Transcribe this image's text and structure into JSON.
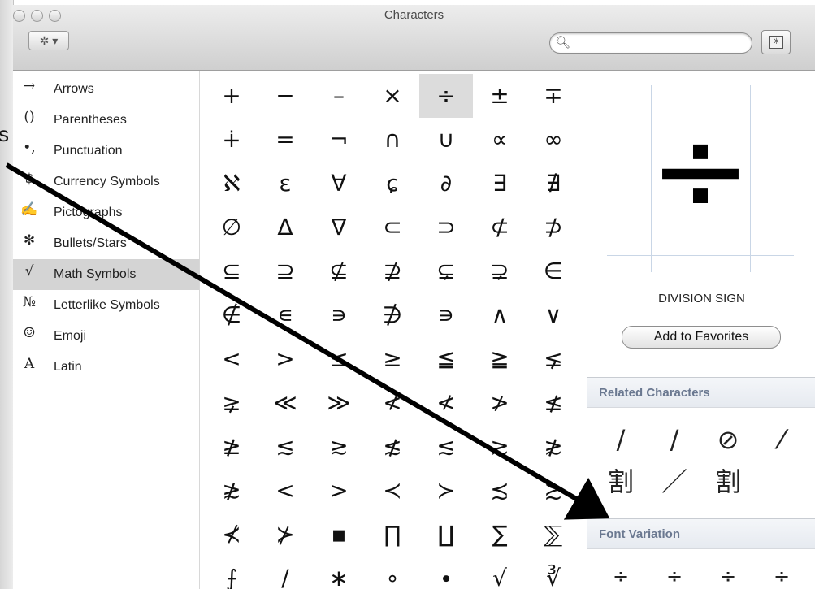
{
  "window": {
    "title": "Characters"
  },
  "toolbar": {
    "action_label": "✲ ▾",
    "search": {
      "value": "",
      "placeholder": ""
    },
    "view_toggle_icon": "keyboard-grid-icon"
  },
  "page_edge_fragment": "s",
  "sidebar": {
    "items": [
      {
        "icon": "→",
        "label": "Arrows"
      },
      {
        "icon": "()",
        "label": "Parentheses"
      },
      {
        "icon": "•,",
        "label": "Punctuation"
      },
      {
        "icon": "$",
        "label": "Currency Symbols"
      },
      {
        "icon": "✍",
        "label": "Pictographs"
      },
      {
        "icon": "✻",
        "label": "Bullets/Stars"
      },
      {
        "icon": "√",
        "label": "Math Symbols"
      },
      {
        "icon": "№",
        "label": "Letterlike Symbols"
      },
      {
        "icon": "☺",
        "label": "Emoji"
      },
      {
        "icon": "A",
        "label": "Latin"
      }
    ],
    "selected_index": 6
  },
  "grid": {
    "rows": [
      [
        "+",
        "−",
        "–",
        "×",
        "÷",
        "±",
        "∓"
      ],
      [
        "∔",
        "=",
        "¬",
        "∩",
        "∪",
        "∝",
        "∞"
      ],
      [
        "ℵ",
        "ɛ",
        "∀",
        "ɕ",
        "∂",
        "∃",
        "∄"
      ],
      [
        "∅",
        "∆",
        "∇",
        "⊂",
        "⊃",
        "⊄",
        "⊅"
      ],
      [
        "⊆",
        "⊇",
        "⊈",
        "⊉",
        "⊊",
        "⊋",
        "∈"
      ],
      [
        "∉",
        "∊",
        "∍",
        "∌",
        "∍",
        "∧",
        "∨"
      ],
      [
        "<",
        ">",
        "≤",
        "≥",
        "≦",
        "≧",
        "⪇"
      ],
      [
        "⪈",
        "≪",
        "≫",
        "≮",
        "≮",
        "≯",
        "≰"
      ],
      [
        "≱",
        "≲",
        "≳",
        "≴",
        "≲",
        "≳",
        "≵"
      ],
      [
        "≵",
        "<",
        ">",
        "≺",
        "≻",
        "≾",
        "≿"
      ],
      [
        "⊀",
        "⊁",
        "▪",
        "∏",
        "∐",
        "∑",
        "⅀"
      ],
      [
        "⨍",
        "∕",
        "∗",
        "∘",
        "∙",
        "√",
        "∛"
      ]
    ],
    "selected": {
      "row": 0,
      "col": 4
    }
  },
  "detail": {
    "glyph": "÷",
    "name": "DIVISION SIGN",
    "favorite_button": "Add to Favorites",
    "related_heading": "Related Characters",
    "related": [
      "/",
      "∕",
      "⊘",
      "⁄",
      "割",
      "／",
      "割"
    ],
    "font_variation_heading": "Font Variation",
    "font_variations": [
      "÷",
      "÷",
      "÷",
      "÷"
    ]
  }
}
